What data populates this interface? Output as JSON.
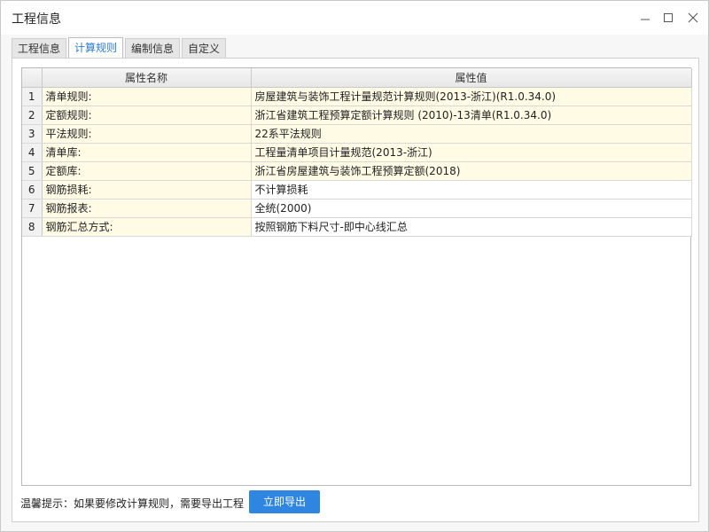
{
  "window": {
    "title": "工程信息"
  },
  "tabs": [
    {
      "label": "工程信息",
      "active": false
    },
    {
      "label": "计算规则",
      "active": true
    },
    {
      "label": "编制信息",
      "active": false
    },
    {
      "label": "自定义",
      "active": false
    }
  ],
  "table": {
    "columns": [
      "属性名称",
      "属性值"
    ],
    "rows": [
      {
        "idx": "1",
        "name": "清单规则:",
        "value": "房屋建筑与装饰工程计量规范计算规则(2013-浙江)(R1.0.34.0)",
        "shade": "yellow"
      },
      {
        "idx": "2",
        "name": "定额规则:",
        "value": "浙江省建筑工程预算定额计算规则 (2010)-13清单(R1.0.34.0)",
        "shade": "yellow"
      },
      {
        "idx": "3",
        "name": "平法规则:",
        "value": "22系平法规则",
        "shade": "yellow"
      },
      {
        "idx": "4",
        "name": "清单库:",
        "value": "工程量清单项目计量规范(2013-浙江)",
        "shade": "yellow"
      },
      {
        "idx": "5",
        "name": "定额库:",
        "value": "浙江省房屋建筑与装饰工程预算定额(2018)",
        "shade": "yellow"
      },
      {
        "idx": "6",
        "name": "钢筋损耗:",
        "value": "不计算损耗",
        "shade": "white"
      },
      {
        "idx": "7",
        "name": "钢筋报表:",
        "value": "全统(2000)",
        "shade": "white"
      },
      {
        "idx": "8",
        "name": "钢筋汇总方式:",
        "value": "按照钢筋下料尺寸-即中心线汇总",
        "shade": "white"
      }
    ]
  },
  "footer": {
    "tip": "温馨提示：如果要修改计算规则，需要导出工程",
    "export_label": "立即导出"
  },
  "colors": {
    "accent": "#2f86e0",
    "active_tab_text": "#2a7bd6",
    "row_highlight": "#fffbe5"
  },
  "icons": {
    "minimize": "minimize-icon",
    "maximize": "maximize-icon",
    "close": "close-icon"
  }
}
